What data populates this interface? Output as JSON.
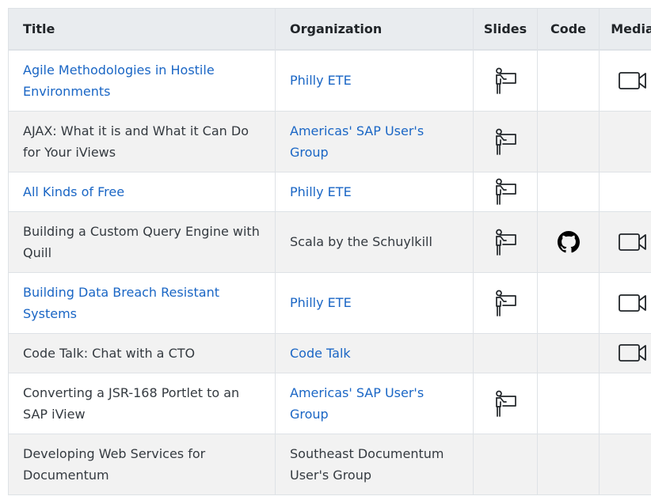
{
  "table": {
    "headers": [
      "Title",
      "Organization",
      "Slides",
      "Code",
      "Media"
    ],
    "rows": [
      {
        "title": "Agile Methodologies in Hostile Environments",
        "title_link": true,
        "org": "Philly ETE",
        "org_link": true,
        "slides": true,
        "code": false,
        "media": true
      },
      {
        "title": "AJAX: What it is and What it Can Do for Your iViews",
        "title_link": false,
        "org": "Americas' SAP User's Group",
        "org_link": true,
        "slides": true,
        "code": false,
        "media": false
      },
      {
        "title": "All Kinds of Free",
        "title_link": true,
        "org": "Philly ETE",
        "org_link": true,
        "slides": true,
        "code": false,
        "media": false
      },
      {
        "title": "Building a Custom Query Engine with Quill",
        "title_link": false,
        "org": "Scala by the Schuylkill",
        "org_link": false,
        "slides": true,
        "code": true,
        "media": true
      },
      {
        "title": "Building Data Breach Resistant Systems",
        "title_link": true,
        "org": "Philly ETE",
        "org_link": true,
        "slides": true,
        "code": false,
        "media": true
      },
      {
        "title": "Code Talk: Chat with a CTO",
        "title_link": false,
        "org": "Code Talk",
        "org_link": true,
        "slides": false,
        "code": false,
        "media": true
      },
      {
        "title": "Converting a JSR-168 Portlet to an SAP iView",
        "title_link": false,
        "org": "Americas' SAP User's Group",
        "org_link": true,
        "slides": true,
        "code": false,
        "media": false
      },
      {
        "title": "Developing Web Services for Documentum",
        "title_link": false,
        "org": "Southeast Documentum User's Group",
        "org_link": false,
        "slides": false,
        "code": false,
        "media": false
      }
    ]
  },
  "icons": {
    "slides": "presentation-icon",
    "code": "github-icon",
    "media": "video-camera-icon"
  },
  "colors": {
    "link": "#1a66c5",
    "header_bg": "#e9ecef",
    "stripe_bg": "#f2f2f2",
    "border": "#dee2e6"
  }
}
